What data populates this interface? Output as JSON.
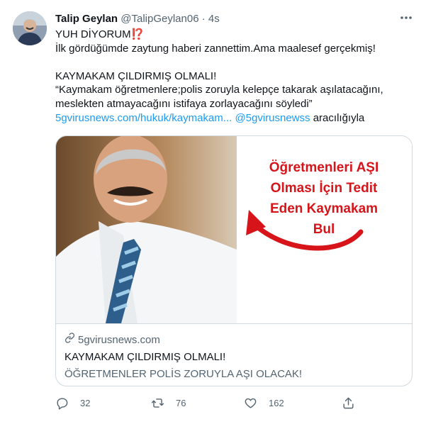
{
  "author": {
    "name": "Talip Geylan",
    "handle": "@TalipGeylan06",
    "separator": "·",
    "time": "4s"
  },
  "tweet": {
    "line1": "YUH DİYORUM",
    "line1_emoji": "⁉️",
    "line2": "İlk gördüğümde zaytung haberi zannettim.Ama maalesef gerçekmiş!",
    "line3": "KAYMAKAM ÇILDIRMIŞ OLMALI!",
    "line4": "“Kaymakam öğretmenlere;polis zoruyla kelepçe takarak aşılatacağını,",
    "line5": "meslekten atmayacağını istifaya zorlayacağını söyledi”",
    "link_url": "5gvirusnews.com/hukuk/kaymakam...",
    "link_mention": "@5gvirusnewss",
    "link_suffix": "aracılığıyla"
  },
  "card": {
    "image_text": [
      "Öğretmenleri AŞI",
      "Olması İçin Tedit",
      "Eden Kaymakam",
      "Bul"
    ],
    "domain": "5gvirusnews.com",
    "title": "KAYMAKAM ÇILDIRMIŞ OLMALI!",
    "description": "ÖĞRETMENLER POLİS ZORUYLA AŞI OLACAK!"
  },
  "actions": {
    "reply_count": "32",
    "retweet_count": "76",
    "like_count": "162"
  },
  "icons": {
    "more": "more-dots-icon",
    "reply": "reply-icon",
    "retweet": "retweet-icon",
    "like": "heart-icon",
    "share": "share-icon",
    "link": "link-icon"
  },
  "colors": {
    "link": "#1d9bf0",
    "secondary_text": "#536471",
    "image_text_red": "#d7141a"
  }
}
